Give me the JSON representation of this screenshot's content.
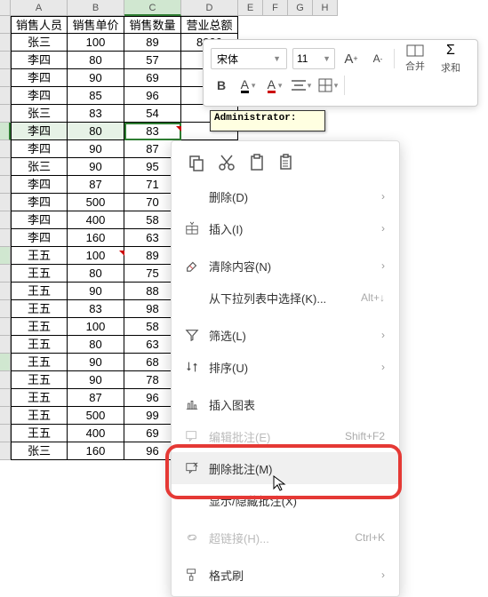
{
  "columns": [
    "A",
    "B",
    "C",
    "D",
    "E",
    "F",
    "G",
    "H"
  ],
  "headers": [
    "销售人员",
    "销售单价",
    "销售数量",
    "营业总额"
  ],
  "rows": [
    [
      "张三",
      "100",
      "89",
      "8900"
    ],
    [
      "李四",
      "80",
      "57",
      ""
    ],
    [
      "李四",
      "90",
      "69",
      ""
    ],
    [
      "李四",
      "85",
      "96",
      ""
    ],
    [
      "张三",
      "83",
      "54",
      ""
    ],
    [
      "李四",
      "80",
      "83",
      ""
    ],
    [
      "李四",
      "90",
      "87",
      ""
    ],
    [
      "张三",
      "90",
      "95",
      ""
    ],
    [
      "李四",
      "87",
      "71",
      ""
    ],
    [
      "李四",
      "500",
      "70",
      ""
    ],
    [
      "李四",
      "400",
      "58",
      ""
    ],
    [
      "李四",
      "160",
      "63",
      ""
    ],
    [
      "王五",
      "100",
      "89",
      ""
    ],
    [
      "王五",
      "80",
      "75",
      ""
    ],
    [
      "王五",
      "90",
      "88",
      ""
    ],
    [
      "王五",
      "83",
      "98",
      ""
    ],
    [
      "王五",
      "100",
      "58",
      ""
    ],
    [
      "王五",
      "80",
      "63",
      ""
    ],
    [
      "王五",
      "90",
      "68",
      ""
    ],
    [
      "王五",
      "90",
      "78",
      ""
    ],
    [
      "王五",
      "87",
      "96",
      ""
    ],
    [
      "王五",
      "500",
      "99",
      ""
    ],
    [
      "王五",
      "400",
      "69",
      ""
    ],
    [
      "张三",
      "160",
      "96",
      ""
    ]
  ],
  "selected_cell": {
    "row_index": 5,
    "col_index": 2
  },
  "highlighted_rows": [
    5,
    12,
    18
  ],
  "toolbar": {
    "font_name": "宋体",
    "font_size": "11",
    "increase_font": "A⁺",
    "decrease_font": "A⁻",
    "bold": "B",
    "merge": "合并",
    "sum": "求和"
  },
  "comment": {
    "author_label": "Administrator:"
  },
  "context_menu": {
    "copy": "复制",
    "cut": "剪切",
    "paste": "粘贴",
    "paste_special": "选择性粘贴",
    "delete": "删除(D)",
    "insert": "插入(I)",
    "clear": "清除内容(N)",
    "dropdown_list": "从下拉列表中选择(K)...",
    "dropdown_shortcut": "Alt+↓",
    "filter": "筛选(L)",
    "sort": "排序(U)",
    "insert_chart": "插入图表",
    "edit_comment": "编辑批注(E)",
    "edit_comment_shortcut": "Shift+F2",
    "delete_comment": "删除批注(M)",
    "toggle_comment": "显示/隐藏批注(X)",
    "hyperlink": "超链接(H)...",
    "hyperlink_shortcut": "Ctrl+K",
    "format_painter": "格式刷"
  }
}
